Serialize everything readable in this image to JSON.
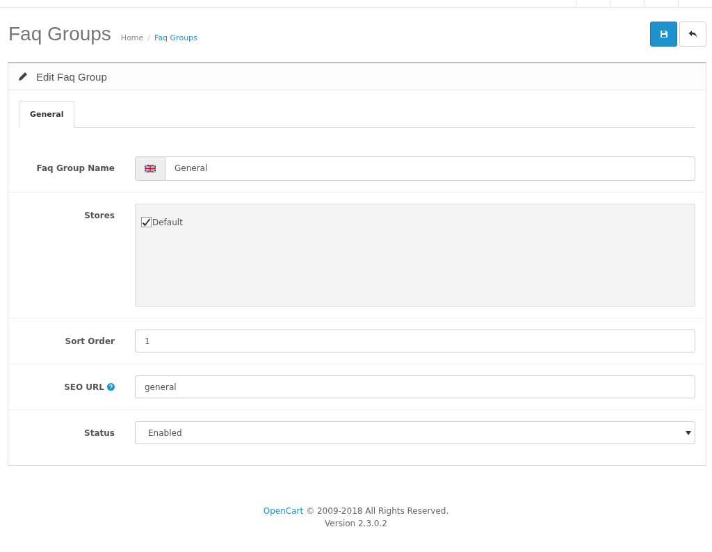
{
  "page": {
    "title": "Faq Groups"
  },
  "breadcrumb_separator": "/",
  "breadcrumb": [
    {
      "label": "Home"
    },
    {
      "label": "Faq Groups"
    }
  ],
  "panel": {
    "title": "Edit Faq Group"
  },
  "tabs": [
    {
      "label": "General",
      "selected": true
    }
  ],
  "fields": [
    {
      "kind": "language",
      "label": "Faq Group Name",
      "value": "General"
    },
    {
      "kind": "stores",
      "label": "Stores",
      "stores": [
        {
          "label": "Default",
          "checked": true
        }
      ]
    },
    {
      "kind": "text",
      "label": "Sort Order",
      "value": "1"
    },
    {
      "kind": "help",
      "label": "SEO URL",
      "value": "general"
    },
    {
      "kind": "select",
      "label": "Status",
      "value": "Enabled"
    }
  ],
  "footer": {
    "link": "OpenCart",
    "text": "© 2009-2018 All Rights Reserved.",
    "version": "Version 2.3.0.2"
  }
}
